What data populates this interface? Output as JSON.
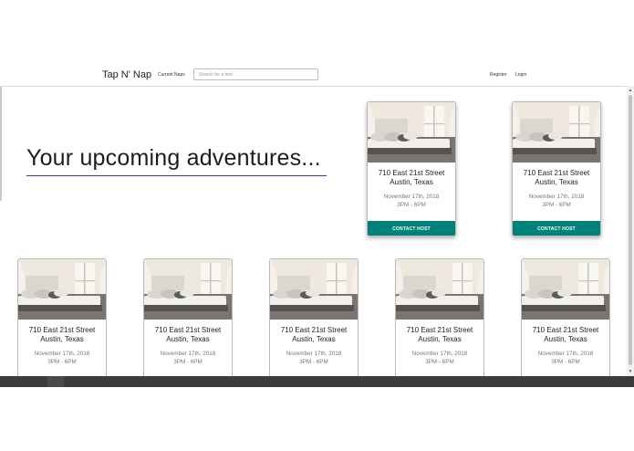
{
  "nav": {
    "brand": "Tap N' Nap",
    "current_naps": "Current Naps",
    "search_placeholder": "Search for a bed",
    "register": "Register",
    "login": "Login"
  },
  "hero": {
    "title": "Your upcoming adventures..."
  },
  "cards": [
    {
      "street": "710 East 21st Street",
      "city": "Austin, Texas",
      "date": "November 17th, 2018",
      "time": "3PM - 6PM",
      "button": "CONTACT HOST"
    },
    {
      "street": "710 East 21st Street",
      "city": "Austin, Texas",
      "date": "November 17th, 2018",
      "time": "3PM - 6PM",
      "button": "CONTACT HOST"
    },
    {
      "street": "710 East 21st Street",
      "city": "Austin, Texas",
      "date": "November 17th, 2018",
      "time": "3PM - 6PM"
    },
    {
      "street": "710 East 21st Street",
      "city": "Austin, Texas",
      "date": "November 17th, 2018",
      "time": "3PM - 6PM"
    },
    {
      "street": "710 East 21st Street",
      "city": "Austin, Texas",
      "date": "November 17th, 2018",
      "time": "3PM - 6PM"
    },
    {
      "street": "710 East 21st Street",
      "city": "Austin, Texas",
      "date": "November 17th, 2018",
      "time": "3PM - 6PM"
    },
    {
      "street": "710 East 21st Street",
      "city": "Austin, Texas",
      "date": "November 17th, 2018",
      "time": "3PM - 6PM"
    }
  ],
  "colors": {
    "accent": "#00817a",
    "underline": "#3a3aa6"
  },
  "icons": {
    "scroll_up": "scroll-up-arrow-icon",
    "scroll_down": "scroll-down-arrow-icon"
  }
}
